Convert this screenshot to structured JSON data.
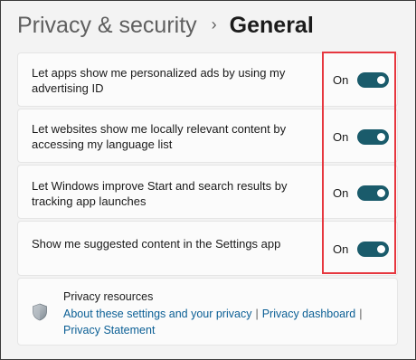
{
  "header": {
    "parent": "Privacy & security",
    "separator": "›",
    "current": "General"
  },
  "settings": [
    {
      "label": "Let apps show me personalized ads by using my advertising ID",
      "state": "On",
      "enabled": true
    },
    {
      "label": "Let websites show me locally relevant content by accessing my language list",
      "state": "On",
      "enabled": true
    },
    {
      "label": "Let Windows improve Start and search results by tracking app launches",
      "state": "On",
      "enabled": true
    },
    {
      "label": "Show me suggested content in the Settings app",
      "state": "On",
      "enabled": true
    }
  ],
  "resources": {
    "title": "Privacy resources",
    "icon": "shield-icon",
    "links": {
      "about": "About these settings and your privacy",
      "dashboard": "Privacy dashboard",
      "statement": "Privacy Statement"
    },
    "separator": "|"
  },
  "colors": {
    "toggle_on": "#1a5b6b",
    "highlight": "#e6373f",
    "link": "#0b5f95"
  }
}
